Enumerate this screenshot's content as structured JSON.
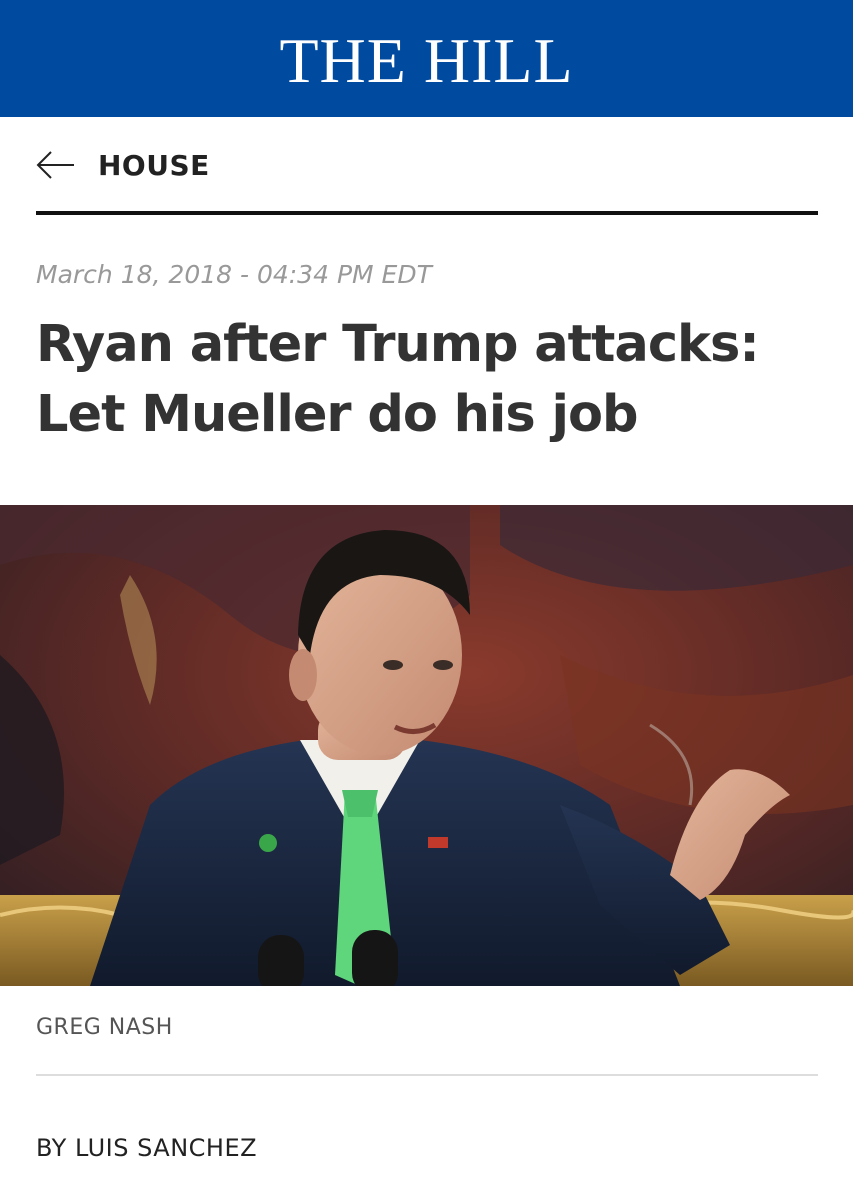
{
  "masthead": {
    "logo": "THE HILL",
    "color": "#004a9f"
  },
  "nav": {
    "back_icon": "arrow-left-icon",
    "section": "HOUSE"
  },
  "article": {
    "dateline": "March 18, 2018 - 04:34 PM EDT",
    "headline": "Ryan after Trump attacks: Let Mueller do his job",
    "photo_credit": "GREG NASH",
    "byline": "BY LUIS SANCHEZ"
  }
}
